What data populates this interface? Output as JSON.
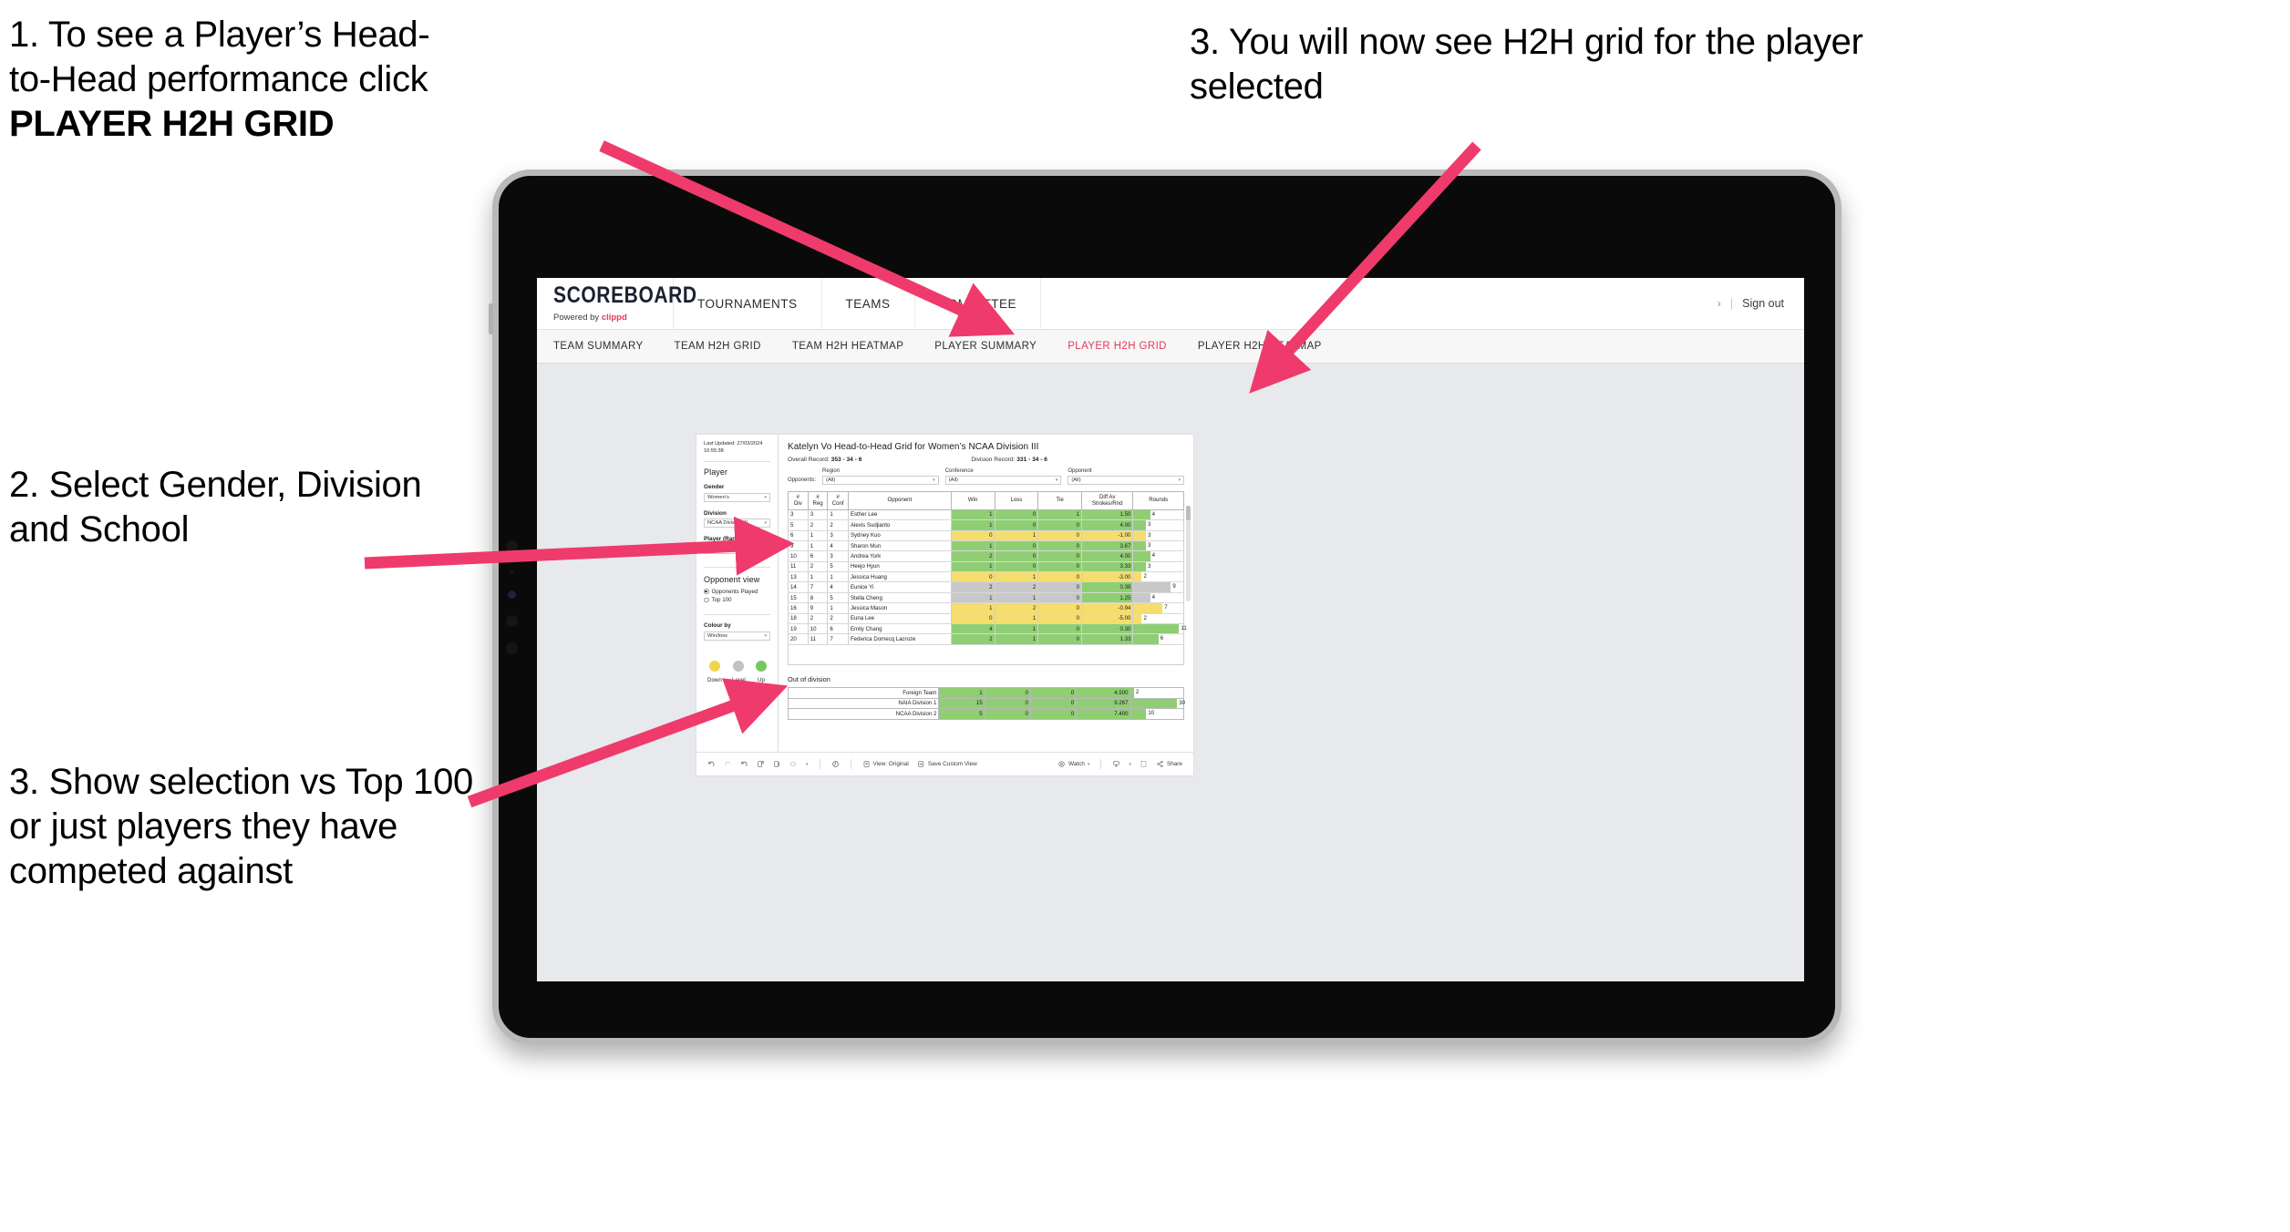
{
  "annotations": {
    "step1_line1": "1. To see a Player’s Head-",
    "step1_line2": "to-Head performance click",
    "step1_bold": "PLAYER H2H GRID",
    "step2": "2. Select Gender, Division and School",
    "step3": "3. Show selection vs Top 100 or just players they have competed against",
    "step4": "3. You will now see H2H grid for the player selected"
  },
  "app": {
    "logo": {
      "main": "SCOREBOARD",
      "powered_prefix": "Powered by ",
      "brand": "clippd"
    },
    "main_nav": [
      "TOURNAMENTS",
      "TEAMS",
      "COMMITTEE"
    ],
    "header_right": {
      "chevron": "›",
      "separator": "|",
      "sign_out": "Sign out"
    },
    "tabs": [
      {
        "label": "TEAM SUMMARY",
        "active": false
      },
      {
        "label": "TEAM H2H GRID",
        "active": false
      },
      {
        "label": "TEAM H2H HEATMAP",
        "active": false
      },
      {
        "label": "PLAYER SUMMARY",
        "active": false
      },
      {
        "label": "PLAYER H2H GRID",
        "active": true
      },
      {
        "label": "PLAYER H2H HEATMAP",
        "active": false
      }
    ],
    "accent_color": "#e8375a"
  },
  "panel": {
    "last_updated_line1": "Last Updated: 27/03/2024",
    "last_updated_line2": "16:55:38",
    "section_player": "Player",
    "filters": [
      {
        "label": "Gender",
        "value": "Women’s"
      },
      {
        "label": "Division",
        "value": "NCAA Division III"
      },
      {
        "label": "Player (Rank)",
        "value": "8. Katelyn Vo"
      }
    ],
    "opponent_view": {
      "title": "Opponent view",
      "options": [
        {
          "label": "Opponents Played",
          "selected": true
        },
        {
          "label": "Top 100",
          "selected": false
        }
      ]
    },
    "colour_by": {
      "label": "Colour by",
      "value": "Win/loss"
    },
    "legend": [
      {
        "label": "Down",
        "color": "#f2d450"
      },
      {
        "label": "Level",
        "color": "#c0c3c5"
      },
      {
        "label": "Up",
        "color": "#78c662"
      }
    ]
  },
  "viz": {
    "title": "Katelyn Vo Head-to-Head Grid for Women’s NCAA Division III",
    "overall_record_label": "Overall Record:",
    "overall_record_value": "353 - 34 - 6",
    "division_record_label": "Division Record:",
    "division_record_value": "331 - 34 - 6",
    "opponents_label": "Opponents:",
    "opponent_filters": [
      {
        "caption": "Region",
        "value": "(All)"
      },
      {
        "caption": "Conference",
        "value": "(All)"
      },
      {
        "caption": "Opponent",
        "value": "(All)"
      }
    ],
    "out_of_division_title": "Out of division"
  },
  "chart_data": {
    "type": "table",
    "title": "Katelyn Vo Head-to-Head Grid for Women’s NCAA Division III",
    "columns": [
      "# Div",
      "# Reg",
      "# Conf",
      "Opponent",
      "Win",
      "Loss",
      "Tie",
      "Diff Av Strokes/Rnd",
      "Rounds"
    ],
    "column_headers_multiline": [
      [
        "#",
        "Div"
      ],
      [
        "#",
        "Reg"
      ],
      [
        "#",
        "Conf"
      ],
      [
        "Opponent"
      ],
      [
        "Win"
      ],
      [
        "Loss"
      ],
      [
        "Tie"
      ],
      [
        "Diff Av",
        "Strokes/Rnd"
      ],
      [
        "Rounds"
      ]
    ],
    "rounds_max": 12,
    "colors": {
      "up": "#8fce73",
      "down": "#f5dd6e",
      "level": "#c8c8c8"
    },
    "rows": [
      {
        "div": "3",
        "reg": "3",
        "conf": "1",
        "opponent": "Esther Lee",
        "win": "1",
        "loss": "0",
        "tie": "1",
        "diff": "1.50",
        "rounds": "4",
        "state": "up"
      },
      {
        "div": "5",
        "reg": "2",
        "conf": "2",
        "opponent": "Alexis Sudjianto",
        "win": "1",
        "loss": "0",
        "tie": "0",
        "diff": "4.00",
        "rounds": "3",
        "state": "up"
      },
      {
        "div": "6",
        "reg": "1",
        "conf": "3",
        "opponent": "Sydney Kuo",
        "win": "0",
        "loss": "1",
        "tie": "0",
        "diff": "-1.00",
        "rounds": "3",
        "state": "down"
      },
      {
        "div": "9",
        "reg": "1",
        "conf": "4",
        "opponent": "Sharon Mun",
        "win": "1",
        "loss": "0",
        "tie": "0",
        "diff": "3.67",
        "rounds": "3",
        "state": "up"
      },
      {
        "div": "10",
        "reg": "6",
        "conf": "3",
        "opponent": "Andrea York",
        "win": "2",
        "loss": "0",
        "tie": "0",
        "diff": "4.00",
        "rounds": "4",
        "state": "up"
      },
      {
        "div": "11",
        "reg": "2",
        "conf": "5",
        "opponent": "Heejo Hyun",
        "win": "1",
        "loss": "0",
        "tie": "0",
        "diff": "3.33",
        "rounds": "3",
        "state": "up"
      },
      {
        "div": "13",
        "reg": "1",
        "conf": "1",
        "opponent": "Jessica Huang",
        "win": "0",
        "loss": "1",
        "tie": "0",
        "diff": "-3.00",
        "rounds": "2",
        "state": "down"
      },
      {
        "div": "14",
        "reg": "7",
        "conf": "4",
        "opponent": "Eunice Yi",
        "win": "2",
        "loss": "2",
        "tie": "0",
        "diff": "0.38",
        "rounds": "9",
        "state": "level",
        "diff_state": "up"
      },
      {
        "div": "15",
        "reg": "8",
        "conf": "5",
        "opponent": "Stella Cheng",
        "win": "1",
        "loss": "1",
        "tie": "0",
        "diff": "1.25",
        "rounds": "4",
        "state": "level",
        "diff_state": "up"
      },
      {
        "div": "16",
        "reg": "9",
        "conf": "1",
        "opponent": "Jessica Mason",
        "win": "1",
        "loss": "2",
        "tie": "0",
        "diff": "-0.94",
        "rounds": "7",
        "state": "down"
      },
      {
        "div": "18",
        "reg": "2",
        "conf": "2",
        "opponent": "Euna Lee",
        "win": "0",
        "loss": "1",
        "tie": "0",
        "diff": "-5.00",
        "rounds": "2",
        "state": "down"
      },
      {
        "div": "19",
        "reg": "10",
        "conf": "6",
        "opponent": "Emily Chang",
        "win": "4",
        "loss": "1",
        "tie": "0",
        "diff": "0.30",
        "rounds": "11",
        "state": "up"
      },
      {
        "div": "20",
        "reg": "11",
        "conf": "7",
        "opponent": "Federica Domecq Lacroze",
        "win": "2",
        "loss": "1",
        "tie": "0",
        "diff": "1.33",
        "rounds": "6",
        "state": "up"
      }
    ],
    "out_of_division": {
      "rounds_max": 34,
      "rows": [
        {
          "name": "Foreign Team",
          "win": "1",
          "loss": "0",
          "tie": "0",
          "diff": "4.500",
          "rounds": "2",
          "state": "up"
        },
        {
          "name": "NAIA Division 1",
          "win": "15",
          "loss": "0",
          "tie": "0",
          "diff": "9.267",
          "rounds": "30",
          "state": "up"
        },
        {
          "name": "NCAA Division 2",
          "win": "5",
          "loss": "0",
          "tie": "0",
          "diff": "7.400",
          "rounds": "10",
          "state": "up"
        }
      ]
    }
  },
  "toolbar": {
    "view_label": "View: Original",
    "save_label": "Save Custom View",
    "watch_label": "Watch",
    "share_label": "Share",
    "caret": "▾"
  }
}
